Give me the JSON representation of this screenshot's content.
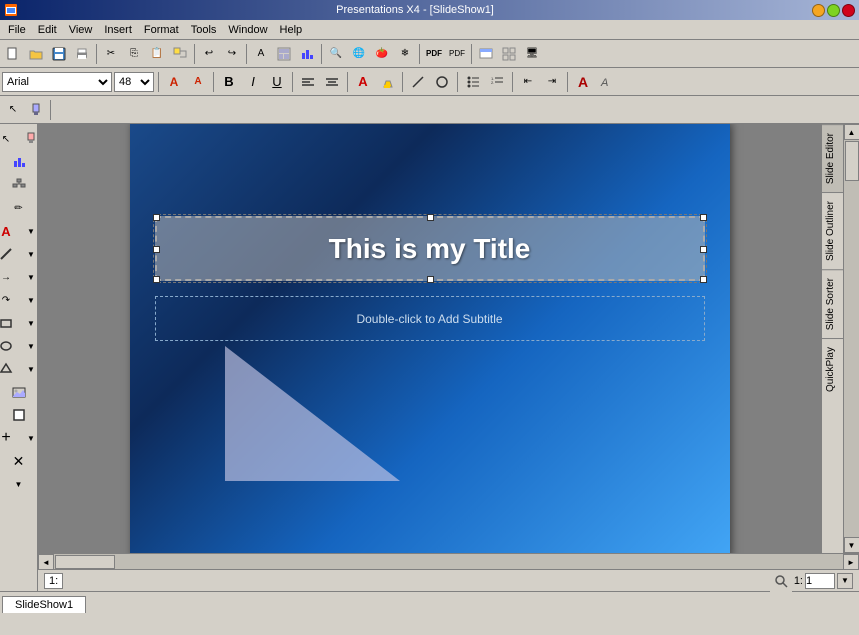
{
  "window": {
    "title": "Presentations X4 - [SlideShow1]",
    "app_icon": "presentation-icon"
  },
  "titlebar": {
    "title": "Presentations X4 - [SlideShow1]",
    "min_label": "–",
    "max_label": "□",
    "close_label": "×"
  },
  "menubar": {
    "items": [
      {
        "label": "File",
        "name": "menu-file"
      },
      {
        "label": "Edit",
        "name": "menu-edit"
      },
      {
        "label": "View",
        "name": "menu-view"
      },
      {
        "label": "Insert",
        "name": "menu-insert"
      },
      {
        "label": "Format",
        "name": "menu-format"
      },
      {
        "label": "Tools",
        "name": "menu-tools"
      },
      {
        "label": "Window",
        "name": "menu-window"
      },
      {
        "label": "Help",
        "name": "menu-help"
      }
    ]
  },
  "format_toolbar": {
    "font_name": "Arial",
    "font_size": "48",
    "bold_label": "B",
    "italic_label": "I",
    "underline_label": "U"
  },
  "slide": {
    "title": "This is my Title",
    "subtitle_placeholder": "Double-click to Add Subtitle"
  },
  "right_panel": {
    "tabs": [
      {
        "label": "Slide Editor",
        "name": "slide-editor-tab"
      },
      {
        "label": "Slide Outliner",
        "name": "slide-outliner-tab"
      },
      {
        "label": "Slide Sorter",
        "name": "slide-sorter-tab"
      },
      {
        "label": "QuickPlay",
        "name": "quickplay-tab"
      }
    ]
  },
  "statusbar": {
    "slide_number": "1:",
    "page_label": "1:",
    "page_input": "1"
  },
  "tab_bar": {
    "tabs": [
      {
        "label": "SlideShow1",
        "name": "slideshow1-tab",
        "active": true
      }
    ]
  }
}
